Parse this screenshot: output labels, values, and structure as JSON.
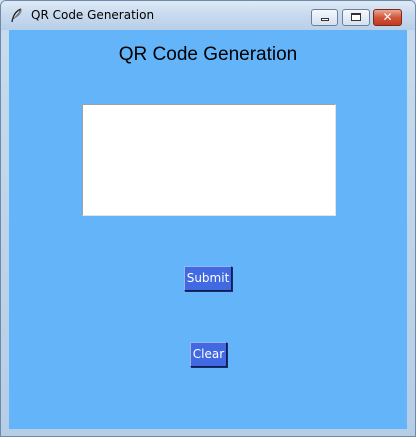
{
  "window": {
    "title": "QR Code Generation",
    "icon": "feather-icon",
    "controls": {
      "minimize_icon": "minimize-icon",
      "maximize_icon": "maximize-icon",
      "close_label": "✕"
    }
  },
  "main": {
    "heading": "QR Code Generation",
    "text_area": {
      "value": ""
    },
    "submit_label": "Submit",
    "clear_label": "Clear"
  },
  "colors": {
    "background": "#64b4f9",
    "button": "#4169e1",
    "button_text": "#ffffff",
    "text_area": "#ffffff"
  }
}
